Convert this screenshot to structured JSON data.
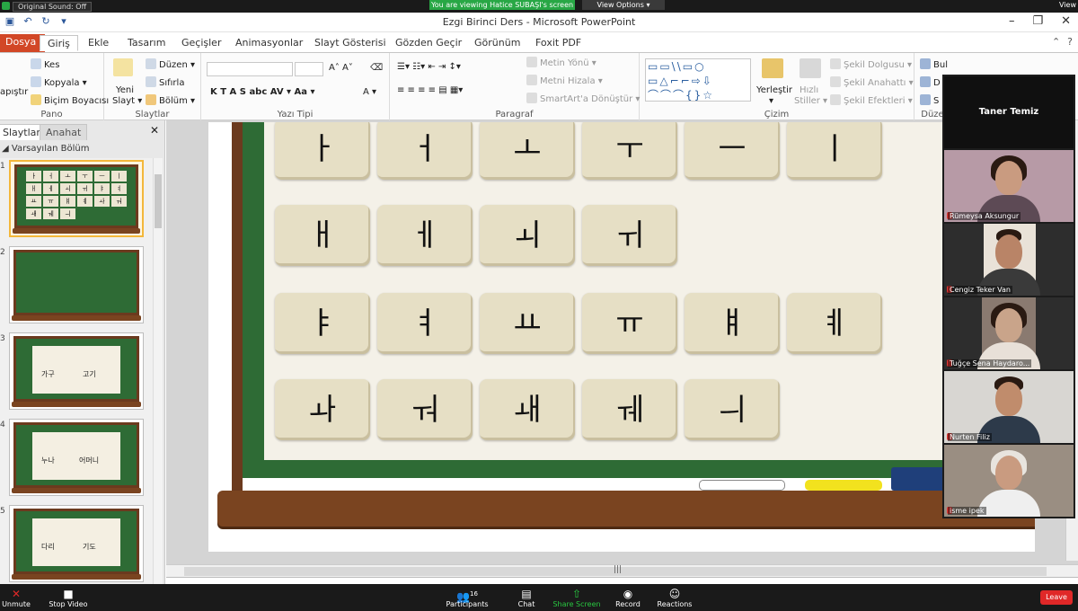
{
  "zoom_top": {
    "sound": "Original Sound: Off",
    "viewing": "You are viewing Hatice SUBAŞI's screen",
    "options": "View Options ▾",
    "view_right": "View"
  },
  "window": {
    "title": "Ezgi Birinci Ders  -  Microsoft PowerPoint"
  },
  "tabs": [
    "Dosya",
    "Giriş",
    "Ekle",
    "Tasarım",
    "Geçişler",
    "Animasyonlar",
    "Slayt Gösterisi",
    "Gözden Geçir",
    "Görünüm",
    "Foxit PDF"
  ],
  "ribbon": {
    "pano": {
      "label": "Pano",
      "paste": "apıştır",
      "cut": "Kes",
      "copy": "Kopyala ▾",
      "format_painter": "Biçim Boyacısı"
    },
    "slaytlar": {
      "label": "Slaytlar",
      "new_slide_1": "Yeni",
      "new_slide_2": "Slayt ▾",
      "layout": "Düzen ▾",
      "reset": "Sıfırla",
      "section": "Bölüm ▾"
    },
    "yazi_tipi": {
      "label": "Yazı Tipi",
      "buttons": "K  T  A  S  abc  AV ▾  Aa ▾",
      "grow": "A˄ A˅",
      "color": "A ▾"
    },
    "paragraf": {
      "label": "Paragraf",
      "text_dir": "Metin Yönü ▾",
      "align_text": "Metni Hizala ▾",
      "smartart": "SmartArt'a Dönüştür ▾"
    },
    "cizim": {
      "label": "Çizim",
      "arrange_1": "Yerleştir",
      "arrange_2": "▾",
      "quick_1": "Hızlı",
      "quick_2": "Stiller ▾",
      "fill": "Şekil Dolgusu ▾",
      "outline": "Şekil Anahattı ▾",
      "effects": "Şekil Efektleri ▾",
      "shapes_row1": "▭▭\\\\▭○",
      "shapes_row2": "▭△⌐⌐⇨⇩",
      "shapes_row3": "⌒⌒⌒{}☆"
    },
    "duzen": {
      "label": "Düze",
      "find": "Bul",
      "replace": "D",
      "select": "S"
    }
  },
  "panel": {
    "tab_slides": "Slaytlar",
    "tab_outline": "Anahat",
    "close": "✕",
    "section_name": "Varsayılan Bölüm",
    "slides": [
      {
        "num": "1",
        "labels": []
      },
      {
        "num": "2",
        "labels": []
      },
      {
        "num": "3",
        "labels": [
          "가구",
          "고기"
        ]
      },
      {
        "num": "4",
        "labels": [
          "누나",
          "어머니"
        ]
      },
      {
        "num": "5",
        "labels": [
          "다리",
          "기도"
        ]
      }
    ],
    "slide1_mini": [
      "ㅏ",
      "ㅓ",
      "ㅗ",
      "ㅜ",
      "ㅡ",
      "ㅣ",
      "ㅐ",
      "ㅔ",
      "ㅚ",
      "ㅟ",
      "ㅑ",
      "ㅕ",
      "ㅛ",
      "ㅠ",
      "ㅒ",
      "ㅖ",
      "ㅘ",
      "ㅝ",
      "ㅙ",
      "ㅞ",
      "ㅢ"
    ]
  },
  "slide": {
    "rows": [
      [
        "ㅏ",
        "ㅓ",
        "ㅗ",
        "ㅜ",
        "ㅡ",
        "ㅣ"
      ],
      [
        "ㅐ",
        "ㅔ",
        "ㅚ",
        "ㅟ"
      ],
      [
        "ㅑ",
        "ㅕ",
        "ㅛ",
        "ㅠ",
        "ㅒ",
        "ㅖ"
      ],
      [
        "ㅘ",
        "ㅝ",
        "ㅙ",
        "ㅞ",
        "ㅢ"
      ]
    ]
  },
  "gallery": {
    "host": "Taner Temiz",
    "participants": [
      "Rümeysa Aksungur",
      "Cengiz Teker Van",
      "Tuğçe Sena Haydaro...",
      "Nurten Filiz",
      "isme ipek"
    ]
  },
  "zoombar": {
    "unmute": "Unmute",
    "stop_video": "Stop Video",
    "participants": "Participants",
    "participants_count": "16",
    "chat": "Chat",
    "share": "Share Screen",
    "record": "Record",
    "reactions": "Reactions",
    "leave": "Leave"
  },
  "colors": {
    "board_green": "#2e6b35",
    "frame_brown": "#6b3a1e",
    "tile": "#e6dfc5",
    "file_tab": "#d24726",
    "zoom_green": "#28a745",
    "leave_red": "#e02828"
  }
}
